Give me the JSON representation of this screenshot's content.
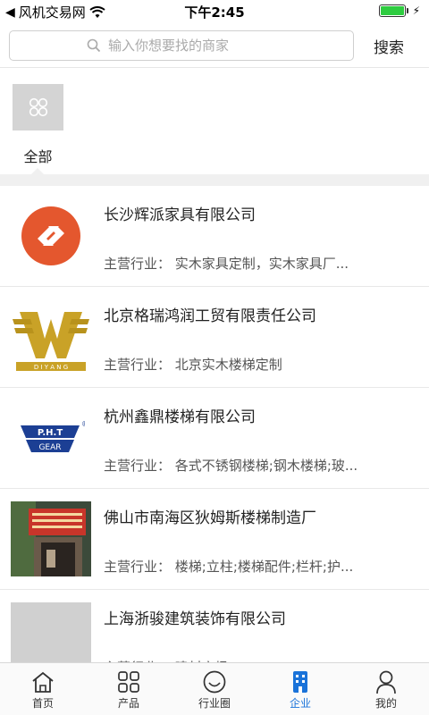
{
  "status": {
    "carrier": "风机交易网",
    "time": "下午2:45"
  },
  "search": {
    "placeholder": "输入你想要找的商家",
    "button": "搜索"
  },
  "category": {
    "label": "全部"
  },
  "companies": [
    {
      "name": "长沙辉派家具有限公司",
      "business": "主营行业：  实木家具定制，实木家具厂..."
    },
    {
      "name": "北京格瑞鸿润工贸有限责任公司",
      "business": "主营行业：  北京实木楼梯定制"
    },
    {
      "name": "杭州鑫鼎楼梯有限公司",
      "business": "主营行业：  各式不锈钢楼梯;钢木楼梯;玻..."
    },
    {
      "name": "佛山市南海区狄姆斯楼梯制造厂",
      "business": "主营行业：  楼梯;立柱;楼梯配件;栏杆;护..."
    },
    {
      "name": "上海浙骏建筑装饰有限公司",
      "business": "主营行业：  建材家场"
    }
  ],
  "logos": {
    "pht_top": "P.H.T",
    "pht_bottom": "GEAR",
    "pht_mark": "®",
    "diyang": "D I Y A N G"
  },
  "tabs": [
    {
      "label": "首页",
      "icon": "home-icon"
    },
    {
      "label": "产品",
      "icon": "grid-icon"
    },
    {
      "label": "行业圈",
      "icon": "smile-icon"
    },
    {
      "label": "企业",
      "icon": "building-icon"
    },
    {
      "label": "我的",
      "icon": "user-icon"
    }
  ],
  "colors": {
    "active_tab": "#1a73d9",
    "battery": "#2ecc40",
    "logo_orange": "#e4572e",
    "logo_gold": "#c9a227",
    "logo_blue": "#1c3f94"
  }
}
